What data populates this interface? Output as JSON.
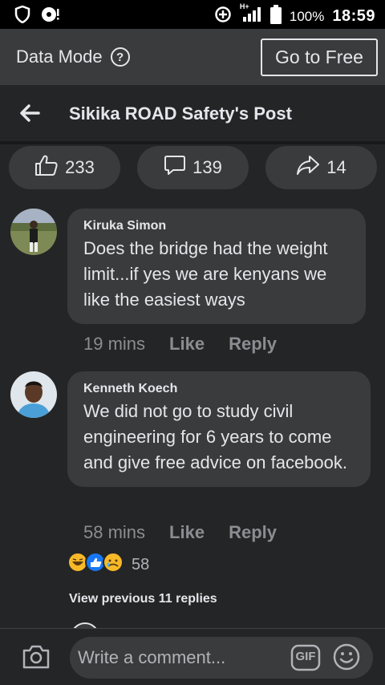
{
  "status_bar": {
    "network_label": "H+",
    "battery": "100%",
    "time": "18:59"
  },
  "data_bar": {
    "label": "Data Mode",
    "help_glyph": "?",
    "go_free_label": "Go to Free"
  },
  "header": {
    "title": "Sikika ROAD Safety's Post"
  },
  "stats": {
    "likes": "233",
    "comments": "139",
    "shares": "14"
  },
  "comments": [
    {
      "author": "Kiruka Simon",
      "text": "Does the bridge had the weight limit...if yes we are kenyans we like the easiest ways",
      "time": "19 mins",
      "like_label": "Like",
      "reply_label": "Reply"
    },
    {
      "author": "Kenneth Koech",
      "text": "We did not go to study civil engineering for 6 years to come and give free advice on facebook.",
      "time": "58 mins",
      "like_label": "Like",
      "reply_label": "Reply",
      "reaction_count": "58",
      "reaction_icons": [
        "laugh-reaction-icon",
        "like-reaction-icon",
        "sad-reaction-icon"
      ]
    }
  ],
  "view_previous": "View previous 11 replies",
  "composer": {
    "placeholder": "Write a comment...",
    "gif_label": "GIF"
  },
  "colors": {
    "background": "#242526",
    "bubble": "#3a3b3c",
    "text": "#e4e6eb",
    "muted": "#8a8d91",
    "like_blue": "#1877f2",
    "reaction_yellow": "#f7b928"
  }
}
